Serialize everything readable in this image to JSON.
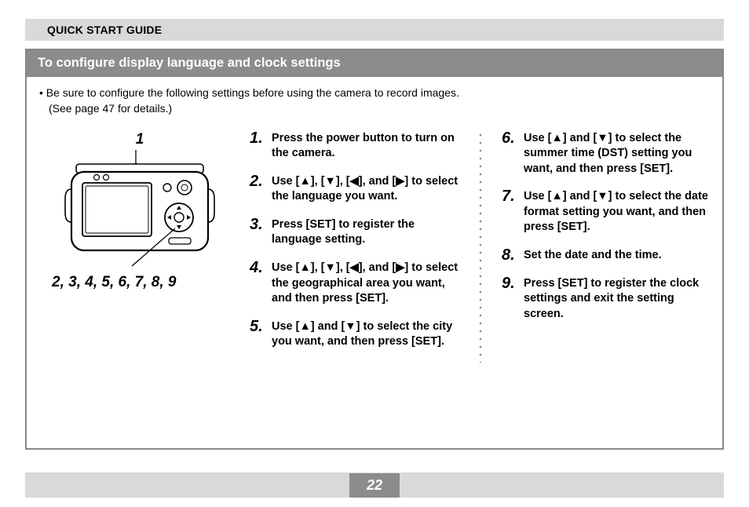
{
  "header": {
    "title": "QUICK START GUIDE"
  },
  "section": {
    "title": "To configure display language and clock settings",
    "note_line1": "• Be sure to configure the following settings before using the camera to record images.",
    "note_line2": "(See page 47 for details.)"
  },
  "figure": {
    "top_label": "1",
    "bottom_label": "2, 3, 4, 5, 6, 7, 8, 9"
  },
  "arrows": {
    "up": "▲",
    "down": "▼",
    "left": "◀",
    "right": "▶"
  },
  "steps_col1": [
    "Press the power button to turn on the camera.",
    "Use [▲], [▼], [◀], and [▶] to select the language you want.",
    "Press [SET] to register the language setting.",
    "Use [▲], [▼], [◀], and [▶] to select the geographical area you want, and then press [SET].",
    "Use [▲] and [▼] to select the city you want, and then press [SET]."
  ],
  "steps_col2": [
    "Use [▲] and [▼] to select the summer time (DST) setting you want, and then press [SET].",
    "Use [▲] and [▼] to select the date format setting you want, and then press [SET].",
    "Set the date and the time.",
    "Press [SET] to register the clock settings and exit the setting screen."
  ],
  "page_number": "22"
}
